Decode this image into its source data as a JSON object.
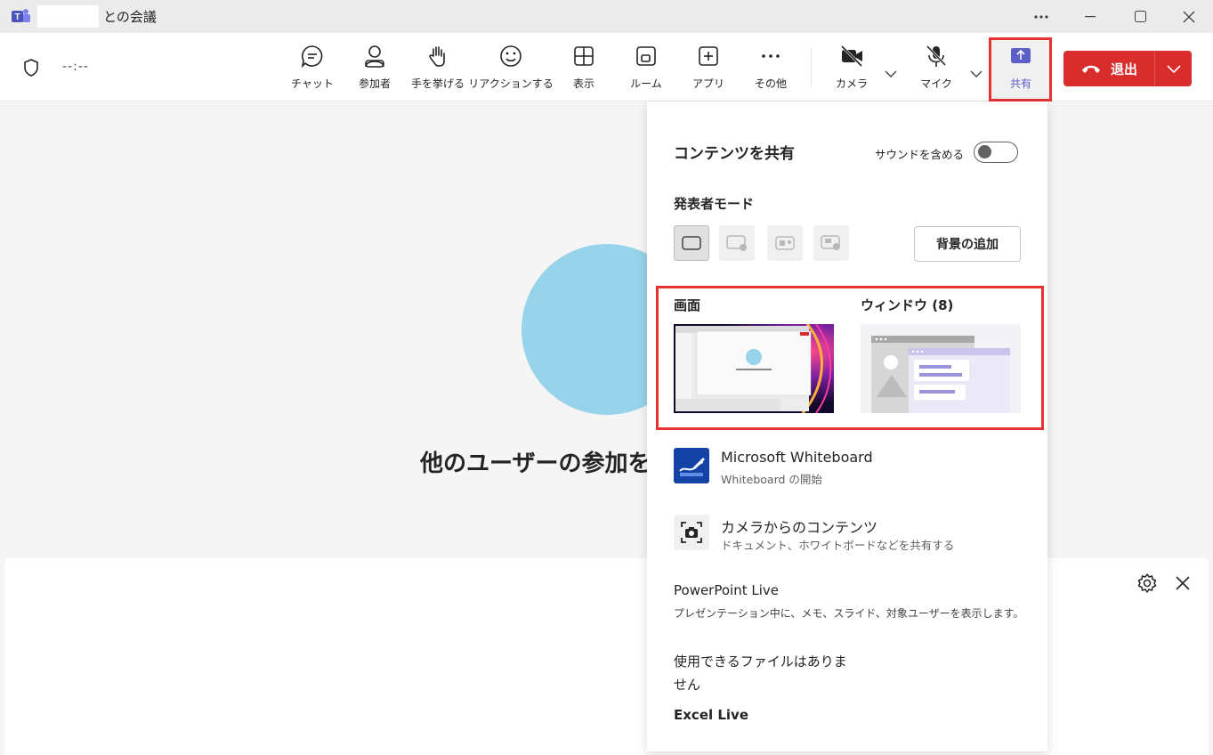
{
  "window": {
    "title": "との会議",
    "more_icon": "ellipsis-icon",
    "minimize_icon": "minimize-icon",
    "maximize_icon": "maximize-icon",
    "close_icon": "close-icon"
  },
  "toolbar": {
    "timer": "--:--",
    "buttons": [
      {
        "label": "チャット",
        "icon": "chat-icon"
      },
      {
        "label": "参加者",
        "icon": "people-icon"
      },
      {
        "label": "手を挙げる",
        "icon": "raise-hand-icon"
      },
      {
        "label": "リアクションする",
        "icon": "emoji-icon"
      },
      {
        "label": "表示",
        "icon": "view-grid-icon"
      },
      {
        "label": "ルーム",
        "icon": "rooms-icon"
      },
      {
        "label": "アプリ",
        "icon": "apps-icon"
      },
      {
        "label": "その他",
        "icon": "more-icon"
      },
      {
        "label": "カメラ",
        "icon": "camera-off-icon"
      },
      {
        "label": "マイク",
        "icon": "mic-off-icon"
      },
      {
        "label": "共有",
        "icon": "share-icon"
      }
    ],
    "leave_label": "退出",
    "leave_color": "#d92c2c",
    "share_accent": "#5b5fc7"
  },
  "stage": {
    "waiting_text": "他のユーザーの参加を"
  },
  "share_panel": {
    "title": "コンテンツを共有",
    "sound_label": "サウンドを含める",
    "sound_enabled": false,
    "presenter_mode_title": "発表者モード",
    "add_background_label": "背景の追加",
    "screen_label": "画面",
    "window_label": "ウィンドウ (8)",
    "screen_thumb_caption": "他のユーザーの参加を待っています...",
    "options": [
      {
        "title": "Microsoft Whiteboard",
        "subtitle": "Whiteboard の開始",
        "icon": "whiteboard-icon"
      },
      {
        "title": "カメラからのコンテンツ",
        "subtitle": "ドキュメント、ホワイトボードなどを共有する",
        "icon": "camera-scan-icon"
      }
    ],
    "powerpoint_title": "PowerPoint Live",
    "powerpoint_sub": "プレゼンテーション中に、メモ、スライド、対象ユーザーを表示します。",
    "no_files": "使用できるファイルはありません",
    "excel_title": "Excel Live"
  },
  "bottom_panel": {
    "settings_icon": "gear-icon",
    "close_icon": "close-icon"
  }
}
